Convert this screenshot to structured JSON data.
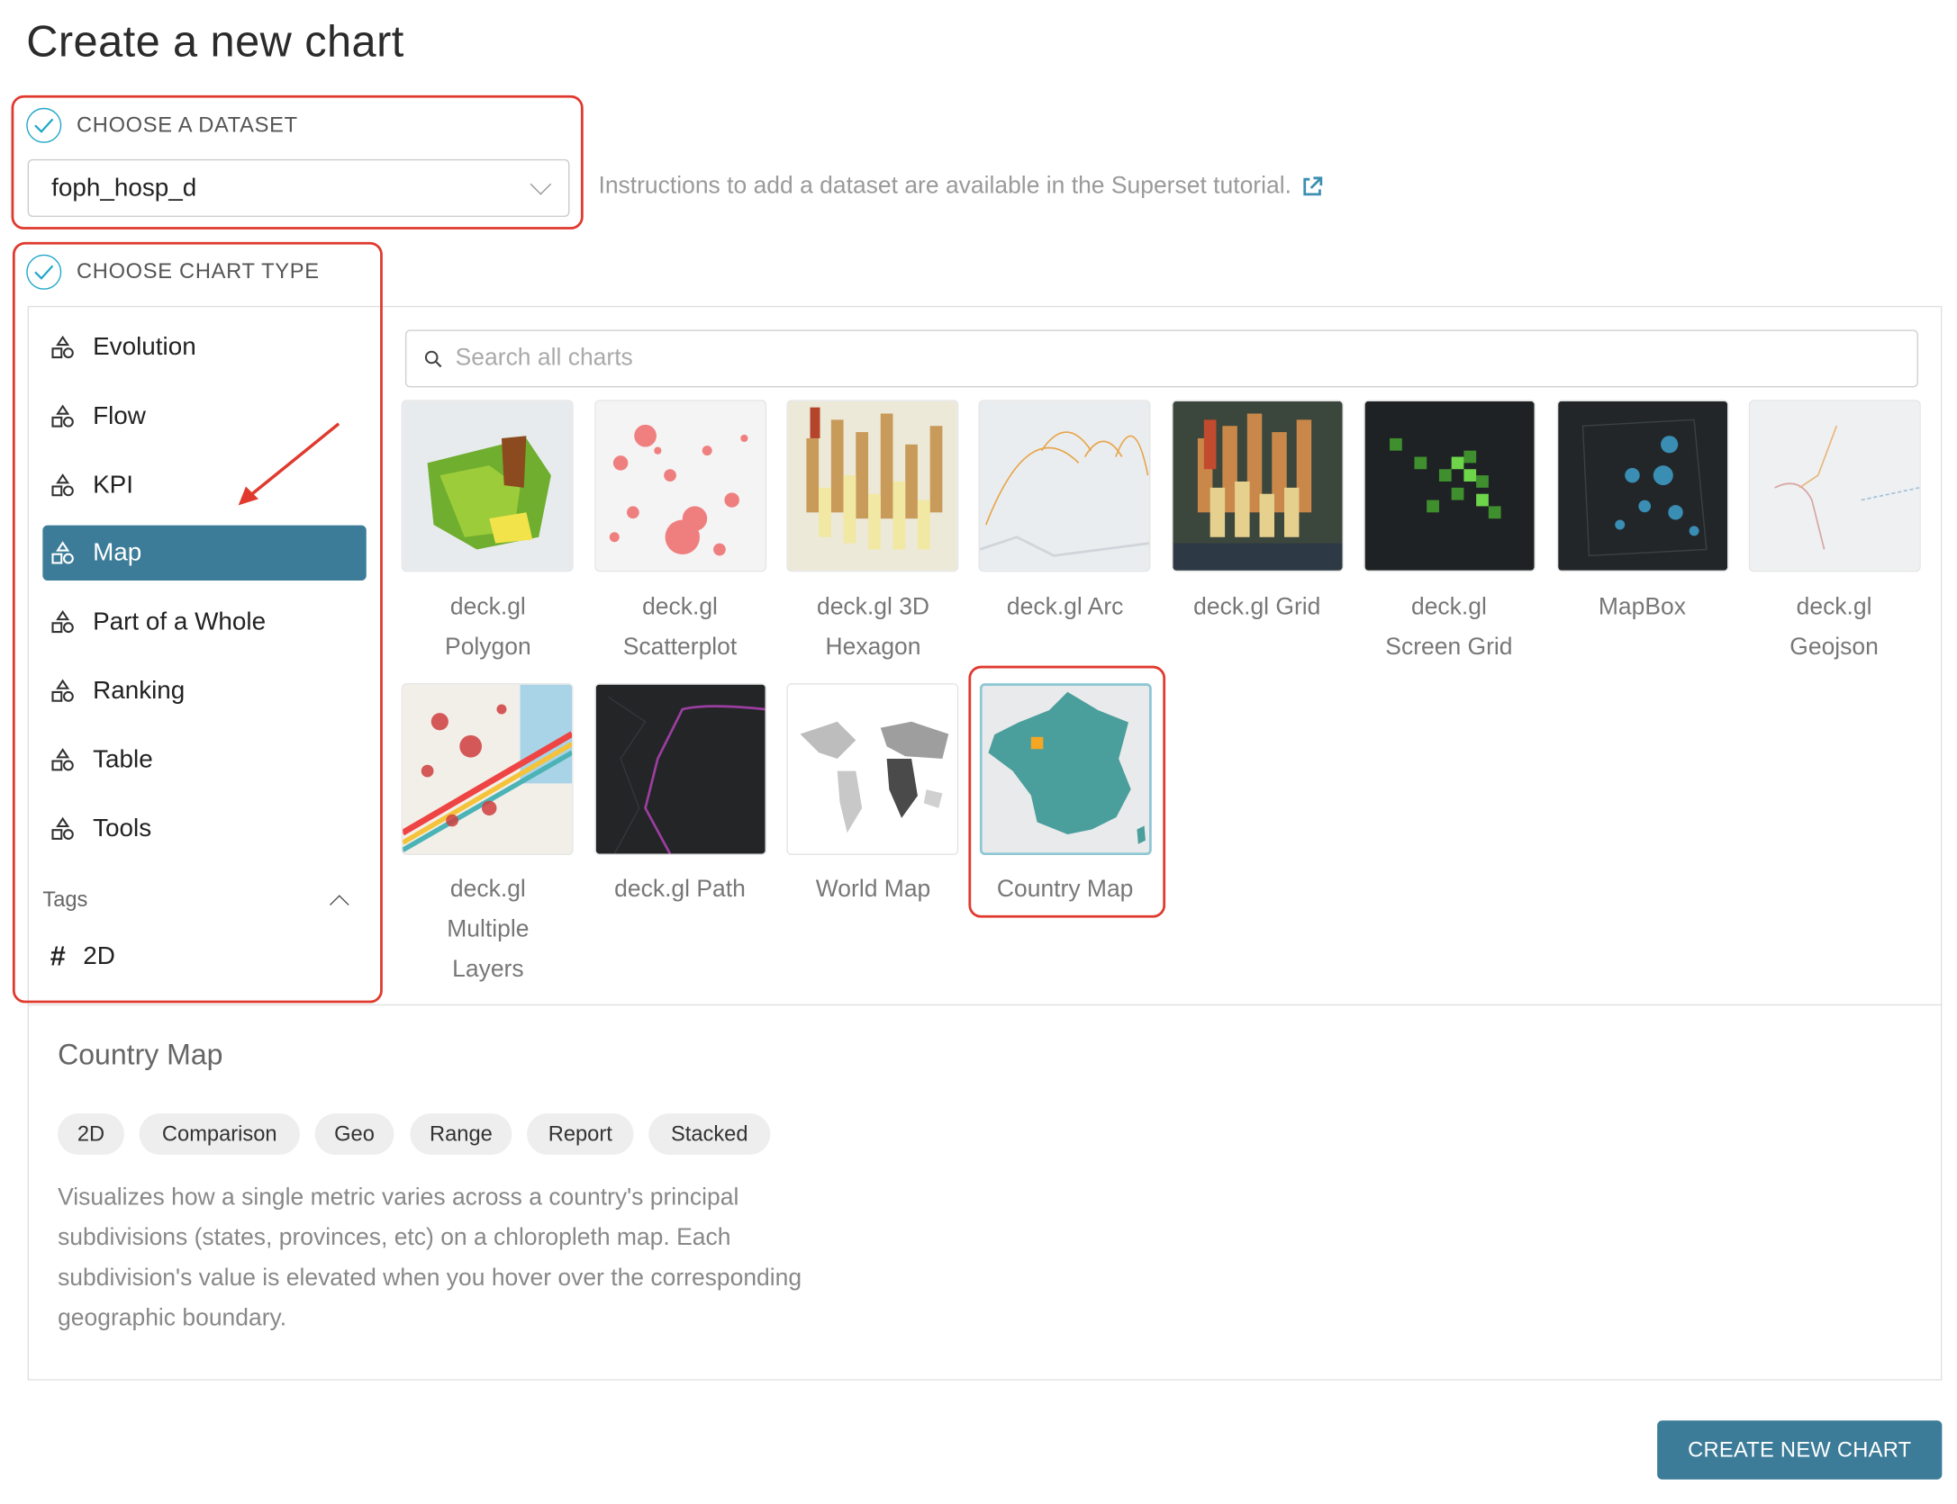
{
  "page": {
    "title": "Create a new chart"
  },
  "dataset": {
    "heading": "CHOOSE A DATASET",
    "selected": "foph_hosp_d",
    "hint": "Instructions to add a dataset are available in the Superset tutorial."
  },
  "chart_type": {
    "heading": "CHOOSE CHART TYPE",
    "categories": [
      {
        "label": "Evolution",
        "icon": "category-icon"
      },
      {
        "label": "Flow",
        "icon": "category-icon"
      },
      {
        "label": "KPI",
        "icon": "category-icon"
      },
      {
        "label": "Map",
        "icon": "category-icon",
        "active": true
      },
      {
        "label": "Part of a Whole",
        "icon": "category-icon"
      },
      {
        "label": "Ranking",
        "icon": "category-icon"
      },
      {
        "label": "Table",
        "icon": "category-icon"
      },
      {
        "label": "Tools",
        "icon": "category-icon"
      }
    ],
    "tags_label": "Tags",
    "tag_items": [
      {
        "label": "2D",
        "icon": "hash-icon"
      }
    ],
    "search_placeholder": "Search all charts",
    "charts_row1": [
      {
        "line1": "deck.gl",
        "line2": "Polygon"
      },
      {
        "line1": "deck.gl",
        "line2": "Scatterplot"
      },
      {
        "line1": "deck.gl 3D",
        "line2": "Hexagon"
      },
      {
        "line1": "deck.gl Arc",
        "line2": ""
      },
      {
        "line1": "deck.gl Grid",
        "line2": ""
      },
      {
        "line1": "deck.gl",
        "line2": "Screen Grid"
      },
      {
        "line1": "MapBox",
        "line2": ""
      },
      {
        "line1": "deck.gl",
        "line2": "Geojson"
      }
    ],
    "charts_row2": [
      {
        "line1": "deck.gl",
        "line2": "Multiple",
        "line3": "Layers"
      },
      {
        "line1": "deck.gl Path",
        "line2": "",
        "line3": ""
      },
      {
        "line1": "World Map",
        "line2": "",
        "line3": ""
      },
      {
        "line1": "Country Map",
        "line2": "",
        "line3": "",
        "selected": true
      }
    ]
  },
  "detail": {
    "title": "Country Map",
    "tags": [
      "2D",
      "Comparison",
      "Geo",
      "Range",
      "Report",
      "Stacked"
    ],
    "description": "Visualizes how a single metric varies across a country's principal subdivisions (states, provinces, etc) on a chloropleth map. Each subdivision's value is elevated when you hover over the corresponding geographic boundary."
  },
  "actions": {
    "create_label": "CREATE NEW CHART"
  },
  "colors": {
    "primary": "#3c7c98",
    "check": "#20a7c9",
    "annotation": "#e03a2e"
  }
}
